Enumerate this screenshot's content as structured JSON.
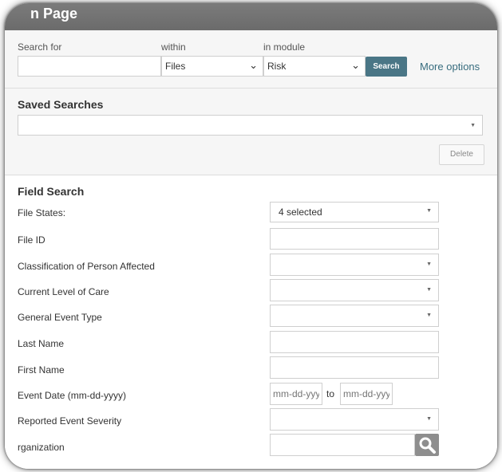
{
  "title": "n Page",
  "search": {
    "search_for_label": "Search for",
    "within_label": "within",
    "module_label": "in module",
    "search_value": "",
    "within_value": "Files",
    "module_value": "Risk",
    "search_button": "Search",
    "more_options": "More options"
  },
  "saved_searches": {
    "heading": "Saved Searches",
    "selected": "",
    "delete_button": "Delete"
  },
  "field_search": {
    "heading": "Field Search",
    "fields": [
      {
        "label": "File States:",
        "type": "select",
        "value": "4 selected"
      },
      {
        "label": "File ID",
        "type": "text",
        "value": ""
      },
      {
        "label": "Classification of Person Affected",
        "type": "select",
        "value": ""
      },
      {
        "label": "Current Level of Care",
        "type": "select",
        "value": ""
      },
      {
        "label": "General Event Type",
        "type": "select",
        "value": ""
      },
      {
        "label": "Last Name",
        "type": "text",
        "value": ""
      },
      {
        "label": "First Name",
        "type": "text",
        "value": ""
      },
      {
        "label": "Event Date (mm-dd-yyyy)",
        "type": "daterange",
        "from_placeholder": "mm-dd-yyy",
        "to_label": "to",
        "to_placeholder": "mm-dd-yyy"
      },
      {
        "label": "Reported Event Severity",
        "type": "select",
        "value": ""
      },
      {
        "label": "rganization",
        "type": "lookup",
        "value": ""
      }
    ]
  },
  "colors": {
    "titlebar": "#6f6f6f",
    "search_button": "#4a7686",
    "link": "#376c7e",
    "panel_bg": "#f6f6f6"
  },
  "icons": {
    "dropdown": "chevron-down-icon",
    "caret": "caret-down-icon",
    "lookup": "magnifier-icon"
  }
}
